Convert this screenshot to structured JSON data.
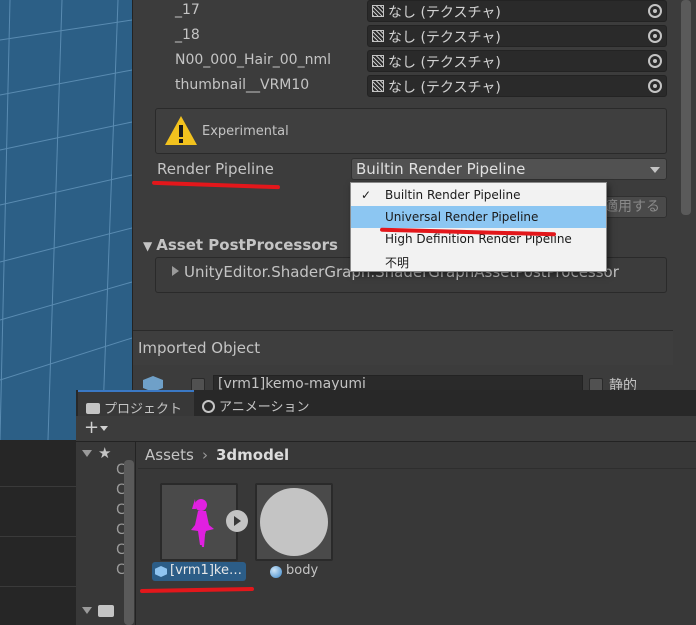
{
  "inspector": {
    "texture_rows": [
      {
        "label": "_17",
        "value": "なし (テクスチャ)"
      },
      {
        "label": "_18",
        "value": "なし (テクスチャ)"
      },
      {
        "label": "N00_000_Hair_00_nml",
        "value": "なし (テクスチャ)"
      },
      {
        "label": "thumbnail__VRM10",
        "value": "なし (テクスチャ)"
      }
    ],
    "experimental_label": "Experimental",
    "render_pipeline_label": "Render Pipeline",
    "render_pipeline_value": "Builtin Render Pipeline",
    "apply_button": "適用する",
    "asset_postprocessors_header": "Asset PostProcessors",
    "postprocessor_item": "UnityEditor.ShaderGraph.ShaderGraphAssetPostProcessor",
    "imported_object_header": "Imported Object",
    "imported_object_name": "[vrm1]kemo-mayumi",
    "static_label": "静的"
  },
  "dropdown": {
    "items": [
      {
        "label": "Builtin Render Pipeline",
        "checked": true
      },
      {
        "label": "Universal Render Pipeline",
        "highlighted": true
      },
      {
        "label": "High Definition Render Pipeline"
      },
      {
        "label": "不明"
      }
    ]
  },
  "project": {
    "tab_project": "プロジェクト",
    "tab_animation": "アニメーション",
    "add_button": "+",
    "breadcrumb_root": "Assets",
    "breadcrumb_sep": "›",
    "breadcrumb_current": "3dmodel",
    "assets": [
      {
        "name": "[vrm1]ke…",
        "selected": true
      },
      {
        "name": "body"
      }
    ]
  },
  "colors": {
    "annotation_red": "#e3171b",
    "selection_blue": "#2c5d87",
    "figure_magenta": "#e020e0"
  }
}
